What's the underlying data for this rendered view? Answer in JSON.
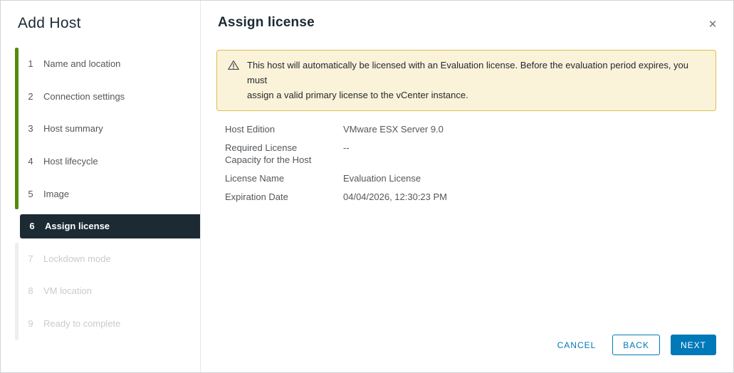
{
  "dialog": {
    "title": "Add Host",
    "panel_title": "Assign license"
  },
  "icons": {
    "close": "✕",
    "warning": "warning-triangle"
  },
  "sidebar": {
    "steps": [
      {
        "num": "1",
        "label": "Name and location",
        "state": "done"
      },
      {
        "num": "2",
        "label": "Connection settings",
        "state": "done"
      },
      {
        "num": "3",
        "label": "Host summary",
        "state": "done"
      },
      {
        "num": "4",
        "label": "Host lifecycle",
        "state": "done"
      },
      {
        "num": "5",
        "label": "Image",
        "state": "done"
      },
      {
        "num": "6",
        "label": "Assign license",
        "state": "active"
      },
      {
        "num": "7",
        "label": "Lockdown mode",
        "state": "future"
      },
      {
        "num": "8",
        "label": "VM location",
        "state": "future"
      },
      {
        "num": "9",
        "label": "Ready to complete",
        "state": "future"
      }
    ]
  },
  "banner": {
    "text": "This host will automatically be licensed with an Evaluation license. Before the evaluation period expires, you must\nassign a valid primary license to the vCenter instance."
  },
  "details": {
    "rows": [
      {
        "label": "Host Edition",
        "value": "VMware ESX Server 9.0"
      },
      {
        "label": "Required License Capacity for the Host",
        "value": "--"
      },
      {
        "label": "License Name",
        "value": "Evaluation License"
      },
      {
        "label": "Expiration Date",
        "value": "04/04/2026, 12:30:23 PM"
      }
    ]
  },
  "footer": {
    "cancel_label": "CANCEL",
    "back_label": "BACK",
    "next_label": "NEXT"
  },
  "colors": {
    "accent_green": "#538c0c",
    "active_step_bg": "#1b2a33",
    "primary_blue": "#0079b8",
    "banner_bg": "#fbf3d9",
    "banner_border": "#dcbe4e",
    "dark_text": "#1b2a32"
  }
}
